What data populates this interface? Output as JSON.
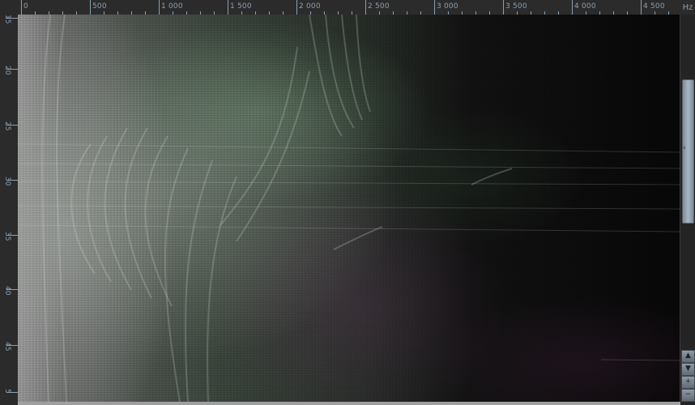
{
  "ruler": {
    "unit": "Hz",
    "frequency_labels": [
      "0",
      "500",
      "1 000",
      "1 500",
      "2 000",
      "2 500",
      "3 000",
      "3 500",
      "4 000",
      "4 500"
    ],
    "time_labels": [
      "15",
      "20",
      "25",
      "30",
      "35",
      "40",
      "45",
      "5"
    ]
  },
  "scrollbar": {
    "grip_glyph": "‹",
    "up_glyph": "▲",
    "down_glyph": "▼",
    "zoom_in_glyph": "+",
    "zoom_out_glyph": "−"
  }
}
